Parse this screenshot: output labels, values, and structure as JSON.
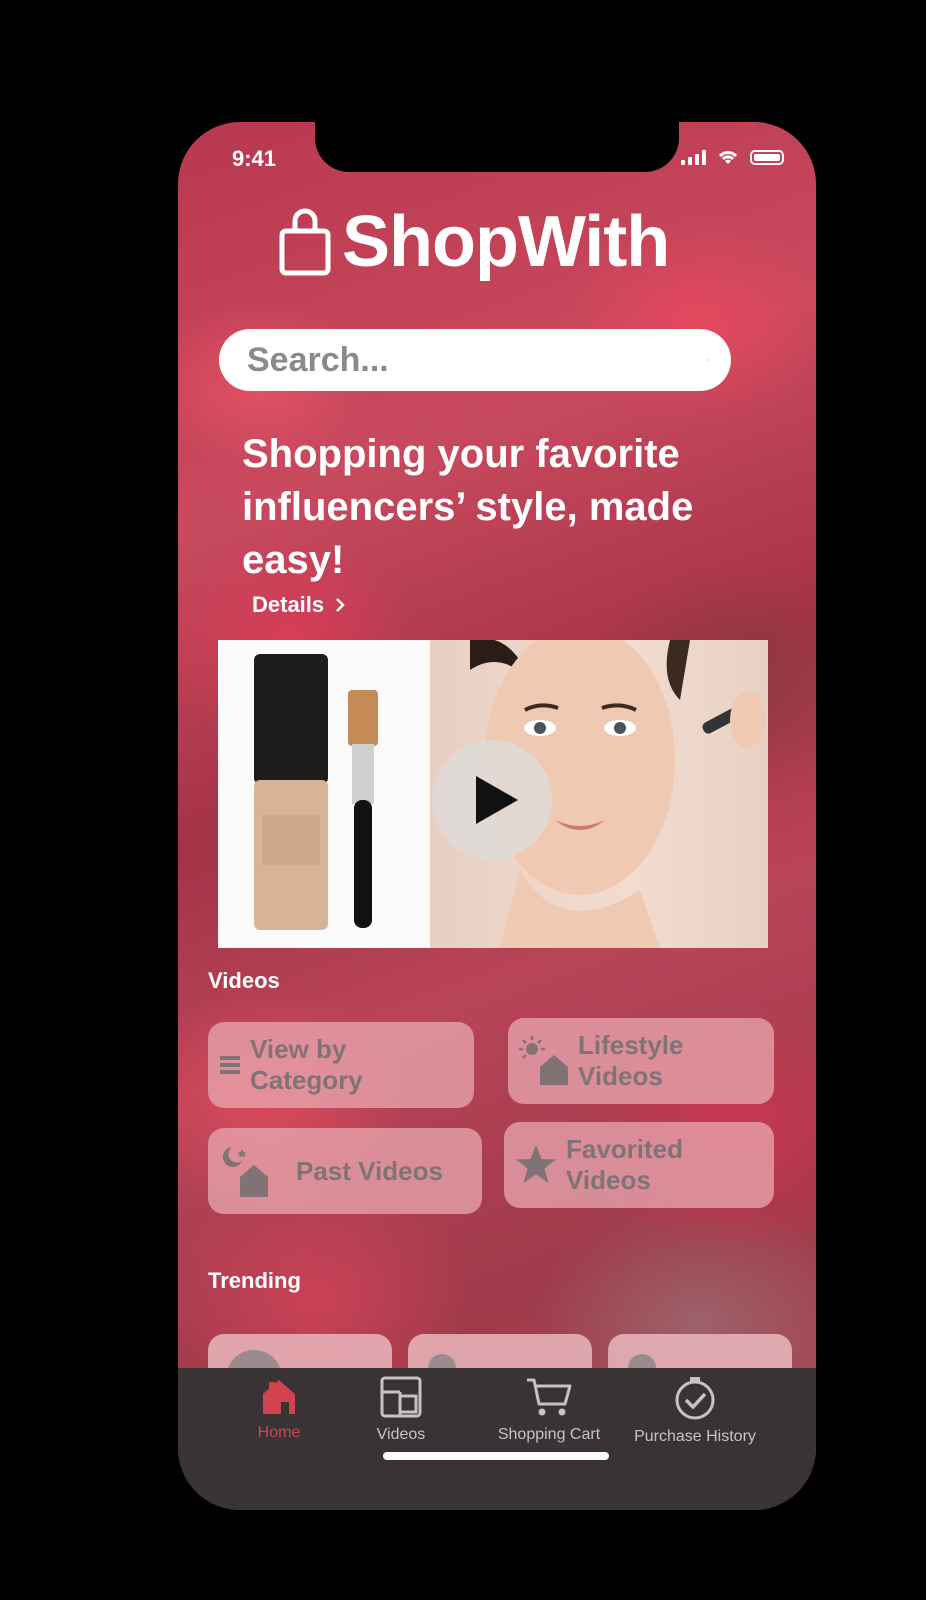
{
  "status": {
    "time": "9:41"
  },
  "brand": {
    "name": "ShopWith"
  },
  "search": {
    "placeholder": "Search..."
  },
  "hero": {
    "headline": "Shopping your favorite influencers’ style, made easy!",
    "details_label": "Details"
  },
  "videos": {
    "section_label": "Videos",
    "buttons": [
      {
        "label": "View by Category",
        "icon": "list-icon"
      },
      {
        "label": "Lifestyle Videos",
        "icon": "sun-house-icon"
      },
      {
        "label": "Past Videos",
        "icon": "moon-house-icon"
      },
      {
        "label": "Favorited Videos",
        "icon": "star-icon"
      }
    ]
  },
  "trending": {
    "section_label": "Trending"
  },
  "tabbar": {
    "items": [
      {
        "label": "Home",
        "icon": "home-icon",
        "active": true
      },
      {
        "label": "Videos",
        "icon": "videos-icon",
        "active": false
      },
      {
        "label": "Shopping Cart",
        "icon": "cart-icon",
        "active": false
      },
      {
        "label": "Purchase History",
        "icon": "check-clock-icon",
        "active": false
      }
    ]
  },
  "colors": {
    "accent": "#d0434f",
    "tabbar_bg": "#3a3336",
    "button_bg": "#e8a8b0"
  }
}
